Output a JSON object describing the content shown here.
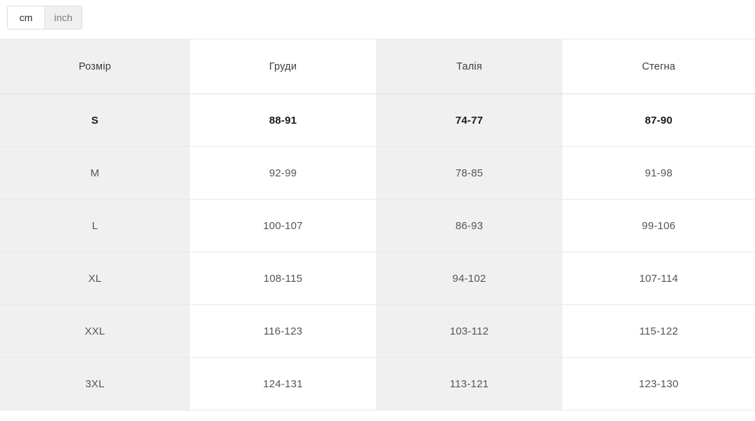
{
  "units": {
    "options": [
      {
        "label": "cm",
        "state": "active"
      },
      {
        "label": "inch",
        "state": "inactive"
      }
    ],
    "selected": "cm"
  },
  "colors": {
    "shaded_column": "#f0f0f0",
    "plain_column": "#ffffff",
    "header_text": "#3d3d3d",
    "body_text": "#555555",
    "highlight_text": "#1a1a1a",
    "row_divider": "#e8e8e8",
    "header_divider": "#dedede",
    "toggle_border": "#dcdcdc",
    "toggle_inactive_bg": "#f0f0f0",
    "toggle_inactive_text": "#7a7a7a"
  },
  "table": {
    "columns": [
      {
        "label": "Розмір",
        "shaded": true
      },
      {
        "label": "Груди",
        "shaded": false
      },
      {
        "label": "Талія",
        "shaded": true
      },
      {
        "label": "Стегна",
        "shaded": false
      }
    ],
    "rows": [
      {
        "highlight": true,
        "cells": [
          "S",
          "88-91",
          "74-77",
          "87-90"
        ]
      },
      {
        "highlight": false,
        "cells": [
          "M",
          "92-99",
          "78-85",
          "91-98"
        ]
      },
      {
        "highlight": false,
        "cells": [
          "L",
          "100-107",
          "86-93",
          "99-106"
        ]
      },
      {
        "highlight": false,
        "cells": [
          "XL",
          "108-115",
          "94-102",
          "107-114"
        ]
      },
      {
        "highlight": false,
        "cells": [
          "XXL",
          "116-123",
          "103-112",
          "115-122"
        ]
      },
      {
        "highlight": false,
        "cells": [
          "3XL",
          "124-131",
          "113-121",
          "123-130"
        ]
      }
    ]
  }
}
